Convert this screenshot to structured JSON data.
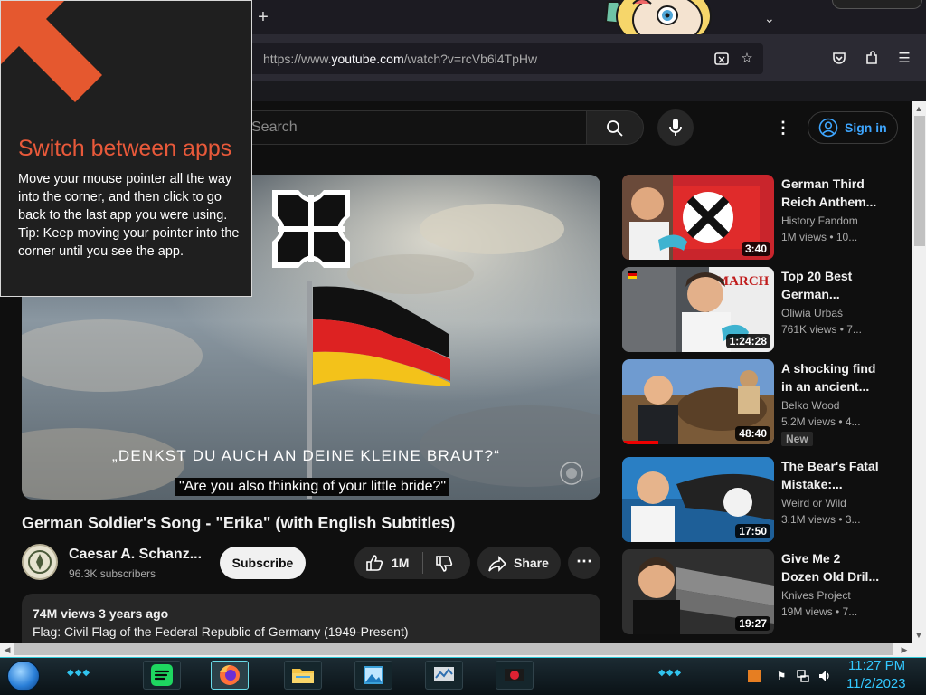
{
  "browser": {
    "url_prefix": "https://www.",
    "url_domain": "youtube.com",
    "url_path": "/watch?v=rcVb6l4TpHw"
  },
  "youtube": {
    "search_placeholder": "Search",
    "sign_in_label": "Sign in",
    "video": {
      "quote_text": "„DENKST DU AUCH AN DEINE KLEINE BRAUT?“",
      "subtitle": "\"Are you also thinking of your little bride?\"",
      "title": "German Soldier's Song - \"Erika\" (with English Subtitles)",
      "channel_name": "Caesar A. Schanz...",
      "channel_subscribers": "96.3K subscribers",
      "subscribe_label": "Subscribe",
      "like_count": "1M",
      "share_label": "Share",
      "views_and_age": "74M views  3 years ago",
      "description": "Flag: Civil Flag of the Federal Republic of Germany (1949-Present)"
    },
    "recommendations": [
      {
        "title": "German Third Reich Anthem...",
        "channel": "History Fandom",
        "meta": "1M views  • 10...",
        "duration": "3:40"
      },
      {
        "title": "Top 20 Best German...",
        "channel": "Oliwia Urbaś",
        "meta": "761K views  • 7...",
        "duration": "1:24:28",
        "thumb_text": "MARCH"
      },
      {
        "title": "A shocking find in an ancient...",
        "channel": "Belko Wood",
        "meta": "5.2M views  • 4...",
        "duration": "48:40",
        "badge": "New"
      },
      {
        "title": "The Bear's Fatal Mistake:...",
        "channel": "Weird or Wild",
        "meta": "3.1M views  • 3...",
        "duration": "17:50"
      },
      {
        "title": "Give Me 2 Dozen Old Dril...",
        "channel": "Knives Project",
        "meta": "19M views  • 7...",
        "duration": "19:27"
      }
    ]
  },
  "tooltip": {
    "heading": "Switch between apps",
    "body": "Move your mouse pointer all the way into the corner, and then click to go back to the last app you were using.",
    "tip": "Tip: Keep moving your pointer into the corner until you see the app."
  },
  "taskbar": {
    "time": "11:27 PM",
    "date": "11/2/2023"
  },
  "colors": {
    "youtube_bg": "#0f0f0f",
    "signin_blue": "#3ea6ff",
    "tooltip_accent": "#e8593a",
    "clock_cyan": "#33c8ff"
  },
  "icons": [
    "plus-icon",
    "chevron-down-icon",
    "translate-icon",
    "bookmark-star-icon",
    "pocket-icon",
    "extensions-icon",
    "hamburger-menu-icon",
    "search-icon",
    "microphone-icon",
    "more-vert-icon",
    "account-icon",
    "thumbs-up-icon",
    "thumbs-down-icon",
    "share-icon",
    "start-orb-icon",
    "spotify-icon",
    "firefox-icon",
    "folder-icon",
    "photos-icon",
    "network-icon",
    "speaker-icon",
    "flag-icon"
  ]
}
